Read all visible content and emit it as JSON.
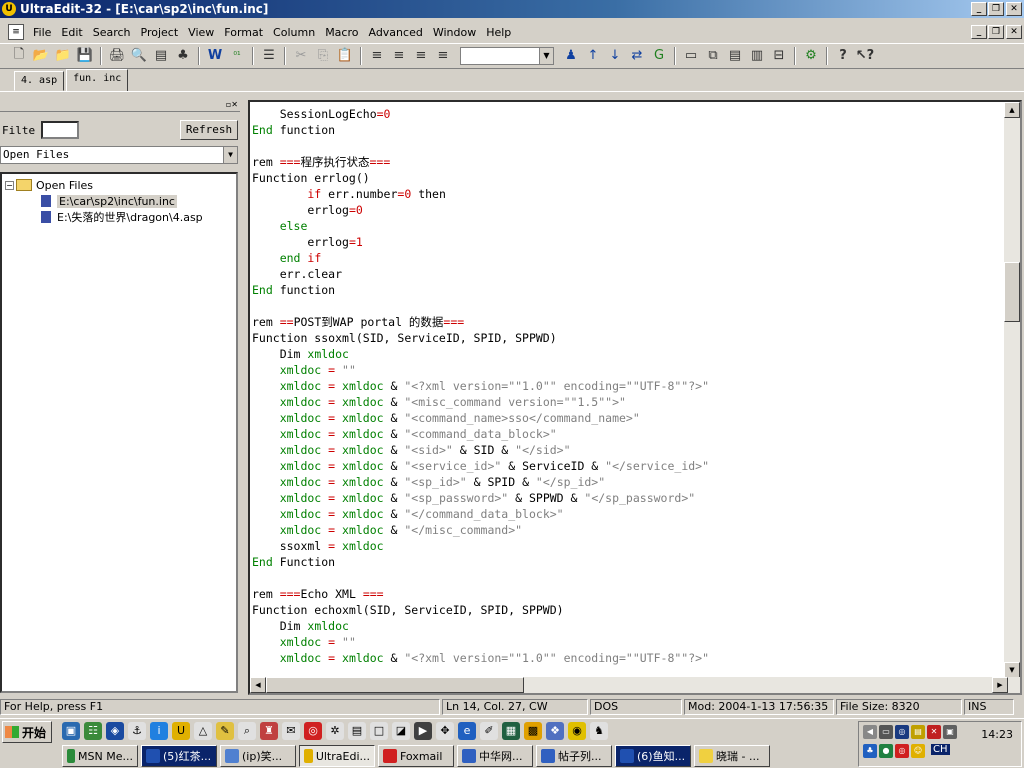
{
  "window": {
    "title": "UltraEdit-32 - [E:\\car\\sp2\\inc\\fun.inc]",
    "icon_label": "U"
  },
  "menu": [
    {
      "label": "File"
    },
    {
      "label": "Edit"
    },
    {
      "label": "Search"
    },
    {
      "label": "Project"
    },
    {
      "label": "View"
    },
    {
      "label": "Format"
    },
    {
      "label": "Column"
    },
    {
      "label": "Macro"
    },
    {
      "label": "Advanced"
    },
    {
      "label": "Window"
    },
    {
      "label": "Help"
    }
  ],
  "toolbar": {
    "icons": [
      "new-file-icon",
      "open-icon",
      "open-folder-icon",
      "save-icon",
      "save-all-icon",
      "print-preview-icon",
      "column-icon",
      "tree-icon",
      "wordwrap-icon",
      "hex-icon",
      "format-icon",
      "cut-icon",
      "copy-icon",
      "paste-icon",
      "print-icon",
      "print-preview2-icon",
      "align-left-icon",
      "align-center-icon",
      "align-right-icon",
      "justify-icon",
      "find-icon",
      "find-prev-icon",
      "find-next-icon",
      "replace-icon",
      "goto-icon",
      "window1-icon",
      "window2-icon",
      "tile-icon",
      "cascade-icon",
      "split-icon",
      "macro-icon",
      "help-icon",
      "whatsthis-icon"
    ],
    "combo_value": ""
  },
  "tabs": [
    {
      "label": "4. asp",
      "active": false
    },
    {
      "label": "fun. inc",
      "active": true
    }
  ],
  "left_panel": {
    "filter_label": "Filte",
    "filter_value": "",
    "refresh_label": "Refresh",
    "view_select": "Open Files",
    "tree": {
      "root": "Open Files",
      "files": [
        "E:\\car\\sp2\\inc\\fun.inc",
        "E:\\失落的世界\\dragon\\4.asp"
      ]
    }
  },
  "code_lines": [
    [
      [
        "n",
        "    SessionLogEcho"
      ],
      [
        "r",
        "=0"
      ]
    ],
    [
      [
        "k",
        "End "
      ],
      [
        "n",
        "function"
      ]
    ],
    [
      [
        "n",
        ""
      ]
    ],
    [
      [
        "n",
        "rem "
      ],
      [
        "r",
        "==="
      ],
      [
        "n",
        "程序执行状态"
      ],
      [
        "r",
        "==="
      ]
    ],
    [
      [
        "n",
        "Function errlog()"
      ]
    ],
    [
      [
        "r",
        "        if "
      ],
      [
        "n",
        "err.number"
      ],
      [
        "r",
        "=0 "
      ],
      [
        "n",
        "then"
      ]
    ],
    [
      [
        "n",
        "        errlog"
      ],
      [
        "r",
        "=0"
      ]
    ],
    [
      [
        "k",
        "    else"
      ]
    ],
    [
      [
        "n",
        "        errlog"
      ],
      [
        "r",
        "=1"
      ]
    ],
    [
      [
        "k",
        "    end "
      ],
      [
        "r",
        "if"
      ]
    ],
    [
      [
        "n",
        "    err.clear"
      ]
    ],
    [
      [
        "k",
        "End "
      ],
      [
        "n",
        "function"
      ]
    ],
    [
      [
        "n",
        ""
      ]
    ],
    [
      [
        "n",
        "rem "
      ],
      [
        "r",
        "=="
      ],
      [
        "n",
        "POST到WAP portal 的数据"
      ],
      [
        "r",
        "==="
      ]
    ],
    [
      [
        "n",
        "Function ssoxml(SID, ServiceID, SPID, SPPWD)"
      ]
    ],
    [
      [
        "n",
        "    Dim "
      ],
      [
        "k",
        "xmldoc"
      ]
    ],
    [
      [
        "k",
        "    xmldoc "
      ],
      [
        "r",
        "= "
      ],
      [
        "s",
        "\"\""
      ]
    ],
    [
      [
        "k",
        "    xmldoc "
      ],
      [
        "r",
        "= "
      ],
      [
        "k",
        "xmldoc "
      ],
      [
        "n",
        "& "
      ],
      [
        "s",
        "\"<?xml version=\"\"1.0\"\" encoding=\"\"UTF-8\"\"?>\""
      ]
    ],
    [
      [
        "k",
        "    xmldoc "
      ],
      [
        "r",
        "= "
      ],
      [
        "k",
        "xmldoc "
      ],
      [
        "n",
        "& "
      ],
      [
        "s",
        "\"<misc_command version=\"\"1.5\"\">\""
      ]
    ],
    [
      [
        "k",
        "    xmldoc "
      ],
      [
        "r",
        "= "
      ],
      [
        "k",
        "xmldoc "
      ],
      [
        "n",
        "& "
      ],
      [
        "s",
        "\"<command_name>sso</command_name>\""
      ]
    ],
    [
      [
        "k",
        "    xmldoc "
      ],
      [
        "r",
        "= "
      ],
      [
        "k",
        "xmldoc "
      ],
      [
        "n",
        "& "
      ],
      [
        "s",
        "\"<command_data_block>\""
      ]
    ],
    [
      [
        "k",
        "    xmldoc "
      ],
      [
        "r",
        "= "
      ],
      [
        "k",
        "xmldoc "
      ],
      [
        "n",
        "& "
      ],
      [
        "s",
        "\"<sid>\" "
      ],
      [
        "n",
        "& SID & "
      ],
      [
        "s",
        "\"</sid>\""
      ]
    ],
    [
      [
        "k",
        "    xmldoc "
      ],
      [
        "r",
        "= "
      ],
      [
        "k",
        "xmldoc "
      ],
      [
        "n",
        "& "
      ],
      [
        "s",
        "\"<service_id>\" "
      ],
      [
        "n",
        "& ServiceID & "
      ],
      [
        "s",
        "\"</service_id>\""
      ]
    ],
    [
      [
        "k",
        "    xmldoc "
      ],
      [
        "r",
        "= "
      ],
      [
        "k",
        "xmldoc "
      ],
      [
        "n",
        "& "
      ],
      [
        "s",
        "\"<sp_id>\" "
      ],
      [
        "n",
        "& SPID & "
      ],
      [
        "s",
        "\"</sp_id>\""
      ]
    ],
    [
      [
        "k",
        "    xmldoc "
      ],
      [
        "r",
        "= "
      ],
      [
        "k",
        "xmldoc "
      ],
      [
        "n",
        "& "
      ],
      [
        "s",
        "\"<sp_password>\" "
      ],
      [
        "n",
        "& SPPWD & "
      ],
      [
        "s",
        "\"</sp_password>\""
      ]
    ],
    [
      [
        "k",
        "    xmldoc "
      ],
      [
        "r",
        "= "
      ],
      [
        "k",
        "xmldoc "
      ],
      [
        "n",
        "& "
      ],
      [
        "s",
        "\"</command_data_block>\""
      ]
    ],
    [
      [
        "k",
        "    xmldoc "
      ],
      [
        "r",
        "= "
      ],
      [
        "k",
        "xmldoc "
      ],
      [
        "n",
        "& "
      ],
      [
        "s",
        "\"</misc_command>\""
      ]
    ],
    [
      [
        "n",
        "    ssoxml "
      ],
      [
        "r",
        "= "
      ],
      [
        "k",
        "xmldoc"
      ]
    ],
    [
      [
        "k",
        "End "
      ],
      [
        "n",
        "Function"
      ]
    ],
    [
      [
        "n",
        ""
      ]
    ],
    [
      [
        "n",
        "rem "
      ],
      [
        "r",
        "==="
      ],
      [
        "n",
        "Echo "
      ],
      [
        "n",
        "XML "
      ],
      [
        "r",
        "==="
      ]
    ],
    [
      [
        "n",
        "Function echoxml(SID, ServiceID, SPID, SPPWD)"
      ]
    ],
    [
      [
        "n",
        "    Dim "
      ],
      [
        "k",
        "xmldoc"
      ]
    ],
    [
      [
        "k",
        "    xmldoc "
      ],
      [
        "r",
        "= "
      ],
      [
        "s",
        "\"\""
      ]
    ],
    [
      [
        "k",
        "    xmldoc "
      ],
      [
        "r",
        "= "
      ],
      [
        "k",
        "xmldoc "
      ],
      [
        "n",
        "& "
      ],
      [
        "s",
        "\"<?xml version=\"\"1.0\"\" encoding=\"\"UTF-8\"\"?>\""
      ]
    ]
  ],
  "status": {
    "help": "For Help, press F1",
    "position": "Ln 14, Col. 27, CW",
    "format": "DOS",
    "modified": "Mod: 2004-1-13 17:56:35",
    "size": "File Size: 8320",
    "mode": "INS"
  },
  "taskbar": {
    "start_label": "开始",
    "tasks": [
      {
        "label": "MSN Me...",
        "color": "#2a8a3a"
      },
      {
        "label": "(5)红茶...",
        "color": "#2050b0",
        "hl": true
      },
      {
        "label": "(ip)笑...",
        "color": "#5080d0"
      },
      {
        "label": "UltraEdi...",
        "color": "#e0b000",
        "active": true
      },
      {
        "label": "Foxmail",
        "color": "#d02020"
      },
      {
        "label": "中华网...",
        "color": "#3060c0"
      },
      {
        "label": "帖子列...",
        "color": "#3060c0"
      },
      {
        "label": "(6)鱼知...",
        "color": "#2050b0",
        "hl": true
      },
      {
        "label": "晓瑞 - ...",
        "color": "#f0d040"
      }
    ],
    "clock": "14:23",
    "ime": "CH"
  }
}
